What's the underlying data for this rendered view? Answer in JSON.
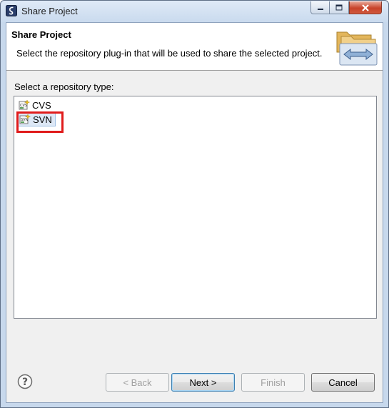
{
  "window": {
    "title": "Share Project",
    "controls": {
      "minimize": "minimize-icon",
      "maximize": "maximize-icon",
      "close": "close-icon"
    }
  },
  "header": {
    "title": "Share Project",
    "description": "Select the repository plug-in that will be used to share the selected project.",
    "image": "share-folders-icon"
  },
  "repository_list": {
    "label": "Select a repository type:",
    "items": [
      {
        "label": "CVS",
        "icon": "cvs-repository-icon",
        "selected": false
      },
      {
        "label": "SVN",
        "icon": "svn-repository-icon",
        "selected": true,
        "highlighted": true
      }
    ]
  },
  "footer": {
    "help_icon": "help-icon",
    "buttons": {
      "back": {
        "label": "< Back",
        "enabled": false
      },
      "next": {
        "label": "Next >",
        "enabled": true,
        "default": true
      },
      "finish": {
        "label": "Finish",
        "enabled": false
      },
      "cancel": {
        "label": "Cancel",
        "enabled": true
      }
    }
  },
  "colors": {
    "highlight_box": "#e01b1b",
    "selection_bg": "#dde8f6",
    "title_bar": "#c9daee",
    "close_button": "#c8432a"
  }
}
